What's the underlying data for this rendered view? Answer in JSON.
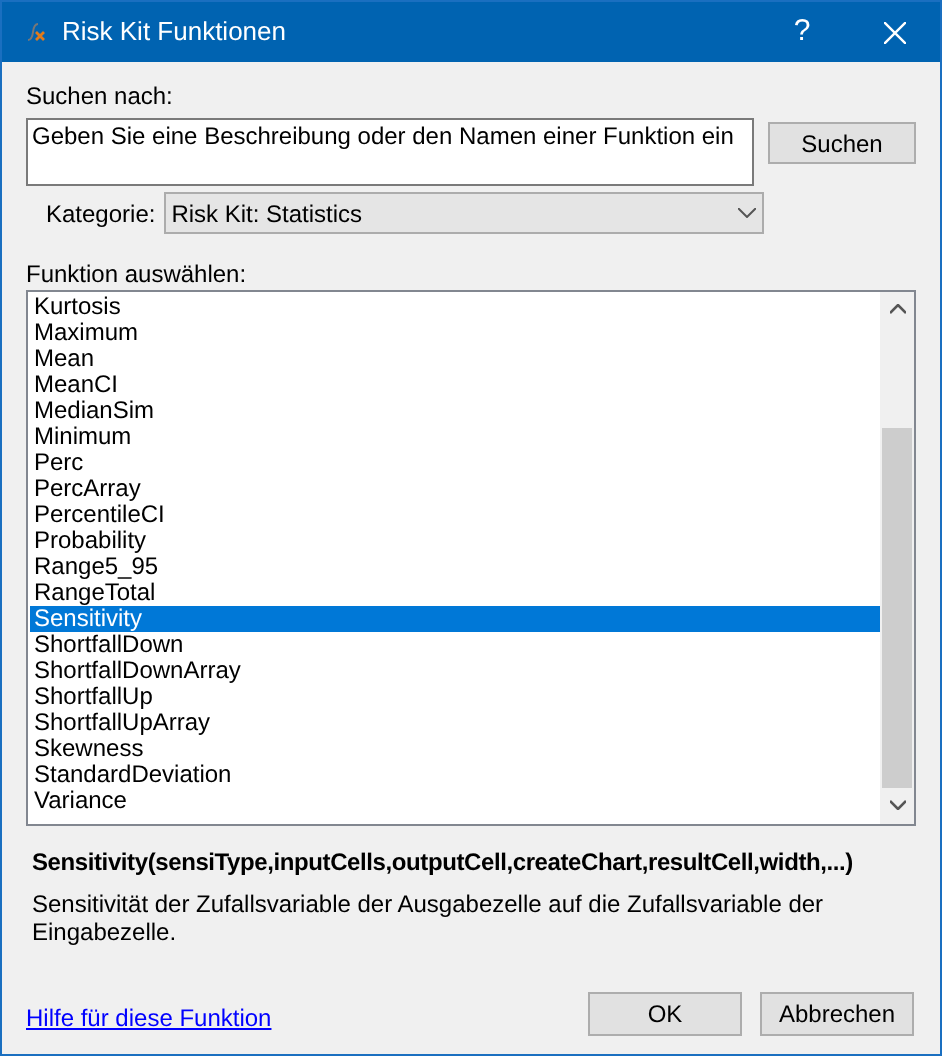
{
  "window": {
    "title": "Risk Kit Funktionen",
    "buttons": [
      "?"
    ]
  },
  "search": {
    "label": "Suchen nach:",
    "value": "Geben Sie eine Beschreibung oder den Namen einer Funktion ein",
    "button": "Suchen"
  },
  "category": {
    "label": "Kategorie:",
    "value": "Risk Kit: Statistics"
  },
  "functions": {
    "label": "Funktion auswählen:",
    "items": [
      {
        "label": "Kurtosis",
        "selected": false
      },
      {
        "label": "Maximum",
        "selected": false
      },
      {
        "label": "Mean",
        "selected": false
      },
      {
        "label": "MeanCI",
        "selected": false
      },
      {
        "label": "MedianSim",
        "selected": false
      },
      {
        "label": "Minimum",
        "selected": false
      },
      {
        "label": "Perc",
        "selected": false
      },
      {
        "label": "PercArray",
        "selected": false
      },
      {
        "label": "PercentileCI",
        "selected": false
      },
      {
        "label": "Probability",
        "selected": false
      },
      {
        "label": "Range5_95",
        "selected": false
      },
      {
        "label": "RangeTotal",
        "selected": false
      },
      {
        "label": "Sensitivity",
        "selected": true
      },
      {
        "label": "ShortfallDown",
        "selected": false
      },
      {
        "label": "ShortfallDownArray",
        "selected": false
      },
      {
        "label": "ShortfallUp",
        "selected": false
      },
      {
        "label": "ShortfallUpArray",
        "selected": false
      },
      {
        "label": "Skewness",
        "selected": false
      },
      {
        "label": "StandardDeviation",
        "selected": false
      },
      {
        "label": "Variance",
        "selected": false
      }
    ]
  },
  "signature": "Sensitivity(sensiType,inputCells,outputCell,createChart,resultCell,width,...)",
  "description": "Sensitivität der Zufallsvariable der Ausgabezelle auf die Zufallsvariable der Eingabezelle.",
  "help_link": "Hilfe für diese Funktion",
  "buttons": [
    "OK",
    "Abbrechen"
  ]
}
